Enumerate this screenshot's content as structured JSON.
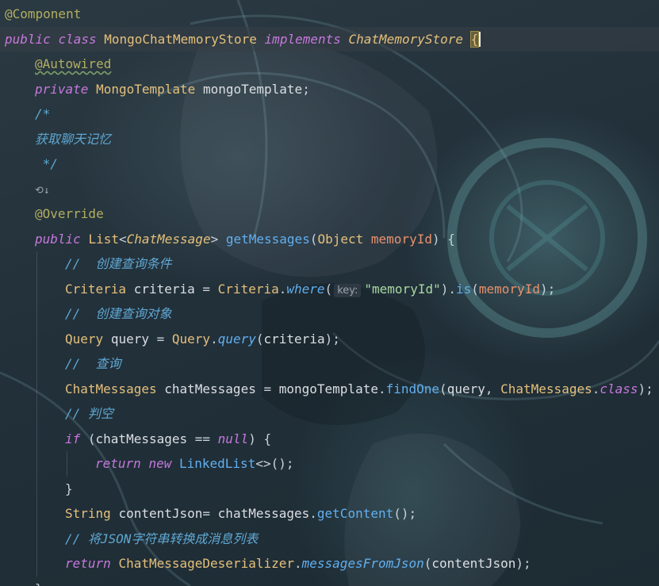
{
  "editor": {
    "language": "Java",
    "lines": [
      {
        "indent": 0,
        "tokens": [
          {
            "t": "@Component",
            "c": "ann"
          }
        ]
      },
      {
        "indent": 0,
        "active": true,
        "tokens": [
          {
            "t": "public",
            "c": "kw"
          },
          {
            "t": " ",
            "c": "punc"
          },
          {
            "t": "class",
            "c": "kw"
          },
          {
            "t": " ",
            "c": "punc"
          },
          {
            "t": "MongoChatMemoryStore",
            "c": "type"
          },
          {
            "t": " ",
            "c": "punc"
          },
          {
            "t": "implements",
            "c": "kw"
          },
          {
            "t": " ",
            "c": "punc"
          },
          {
            "t": "ChatMemoryStore",
            "c": "itype"
          },
          {
            "t": " ",
            "c": "punc"
          },
          {
            "t": "{",
            "c": "brace-hl",
            "caret": true
          }
        ]
      },
      {
        "indent": 1,
        "tokens": [
          {
            "t": "@Autowired",
            "c": "ann squiggle"
          }
        ]
      },
      {
        "indent": 1,
        "tokens": [
          {
            "t": "private",
            "c": "kw"
          },
          {
            "t": " ",
            "c": "punc"
          },
          {
            "t": "MongoTemplate",
            "c": "type"
          },
          {
            "t": " ",
            "c": "punc"
          },
          {
            "t": "mongoTemplate",
            "c": "var"
          },
          {
            "t": ";",
            "c": "punc"
          }
        ]
      },
      {
        "indent": 1,
        "tokens": [
          {
            "t": "/*",
            "c": "cmt"
          }
        ]
      },
      {
        "indent": 1,
        "tokens": [
          {
            "t": "获取聊天记忆",
            "c": "cmt"
          }
        ]
      },
      {
        "indent": 1,
        "tokens": [
          {
            "t": " */",
            "c": "cmt"
          }
        ]
      },
      {
        "indent": 1,
        "tokens": [
          {
            "t": "⟲↓",
            "c": "gutter-icon"
          }
        ]
      },
      {
        "indent": 1,
        "tokens": [
          {
            "t": "@Override",
            "c": "ann"
          }
        ]
      },
      {
        "indent": 1,
        "tokens": [
          {
            "t": "public",
            "c": "kw"
          },
          {
            "t": " ",
            "c": "punc"
          },
          {
            "t": "List",
            "c": "type"
          },
          {
            "t": "<",
            "c": "punc"
          },
          {
            "t": "ChatMessage",
            "c": "itype"
          },
          {
            "t": ">",
            "c": "punc"
          },
          {
            "t": " ",
            "c": "punc"
          },
          {
            "t": "getMessages",
            "c": "fn"
          },
          {
            "t": "(",
            "c": "punc"
          },
          {
            "t": "Object",
            "c": "type"
          },
          {
            "t": " ",
            "c": "punc"
          },
          {
            "t": "memoryId",
            "c": "param"
          },
          {
            "t": ") {",
            "c": "punc"
          }
        ]
      },
      {
        "indent": 2,
        "tokens": [
          {
            "t": "//  创建查询条件",
            "c": "cmt"
          }
        ]
      },
      {
        "indent": 2,
        "tokens": [
          {
            "t": "Criteria",
            "c": "type"
          },
          {
            "t": " ",
            "c": "punc"
          },
          {
            "t": "criteria",
            "c": "var"
          },
          {
            "t": " = ",
            "c": "punc"
          },
          {
            "t": "Criteria",
            "c": "type"
          },
          {
            "t": ".",
            "c": "punc"
          },
          {
            "t": "where",
            "c": "sfn"
          },
          {
            "t": "(",
            "c": "punc"
          },
          {
            "t": "key:",
            "c": "hint"
          },
          {
            "t": "\"memoryId\"",
            "c": "str"
          },
          {
            "t": ").",
            "c": "punc"
          },
          {
            "t": "is",
            "c": "fn"
          },
          {
            "t": "(",
            "c": "punc"
          },
          {
            "t": "memoryId",
            "c": "param"
          },
          {
            "t": ");",
            "c": "punc"
          }
        ]
      },
      {
        "indent": 2,
        "tokens": [
          {
            "t": "//  创建查询对象",
            "c": "cmt"
          }
        ]
      },
      {
        "indent": 2,
        "tokens": [
          {
            "t": "Query",
            "c": "type"
          },
          {
            "t": " ",
            "c": "punc"
          },
          {
            "t": "query",
            "c": "var"
          },
          {
            "t": " = ",
            "c": "punc"
          },
          {
            "t": "Query",
            "c": "type"
          },
          {
            "t": ".",
            "c": "punc"
          },
          {
            "t": "query",
            "c": "sfn"
          },
          {
            "t": "(",
            "c": "punc"
          },
          {
            "t": "criteria",
            "c": "var"
          },
          {
            "t": ");",
            "c": "punc"
          }
        ]
      },
      {
        "indent": 2,
        "tokens": [
          {
            "t": "//  查询",
            "c": "cmt"
          }
        ]
      },
      {
        "indent": 2,
        "tokens": [
          {
            "t": "ChatMessages",
            "c": "type"
          },
          {
            "t": " ",
            "c": "punc"
          },
          {
            "t": "chatMessages",
            "c": "var"
          },
          {
            "t": " = ",
            "c": "punc"
          },
          {
            "t": "mongoTemplate",
            "c": "var"
          },
          {
            "t": ".",
            "c": "punc"
          },
          {
            "t": "findOne",
            "c": "fn"
          },
          {
            "t": "(",
            "c": "punc"
          },
          {
            "t": "query",
            "c": "var"
          },
          {
            "t": ", ",
            "c": "punc"
          },
          {
            "t": "ChatMessages",
            "c": "type"
          },
          {
            "t": ".",
            "c": "punc"
          },
          {
            "t": "class",
            "c": "kw"
          },
          {
            "t": ");",
            "c": "punc"
          }
        ]
      },
      {
        "indent": 2,
        "tokens": [
          {
            "t": "// 判空",
            "c": "cmt"
          }
        ]
      },
      {
        "indent": 2,
        "tokens": [
          {
            "t": "if",
            "c": "kw"
          },
          {
            "t": " (",
            "c": "punc"
          },
          {
            "t": "chatMessages",
            "c": "var"
          },
          {
            "t": " == ",
            "c": "punc"
          },
          {
            "t": "null",
            "c": "kw"
          },
          {
            "t": ") {",
            "c": "punc"
          }
        ]
      },
      {
        "indent": 3,
        "tokens": [
          {
            "t": "return",
            "c": "kw"
          },
          {
            "t": " ",
            "c": "punc"
          },
          {
            "t": "new",
            "c": "kw"
          },
          {
            "t": " ",
            "c": "punc"
          },
          {
            "t": "LinkedList",
            "c": "fn"
          },
          {
            "t": "<>();",
            "c": "punc"
          }
        ]
      },
      {
        "indent": 2,
        "tokens": [
          {
            "t": "}",
            "c": "punc"
          }
        ]
      },
      {
        "indent": 2,
        "tokens": [
          {
            "t": "String",
            "c": "type"
          },
          {
            "t": " ",
            "c": "punc"
          },
          {
            "t": "contentJson",
            "c": "var"
          },
          {
            "t": "= ",
            "c": "punc"
          },
          {
            "t": "chatMessages",
            "c": "var"
          },
          {
            "t": ".",
            "c": "punc"
          },
          {
            "t": "getContent",
            "c": "fn"
          },
          {
            "t": "();",
            "c": "punc"
          }
        ]
      },
      {
        "indent": 2,
        "tokens": [
          {
            "t": "// 将JSON字符串转换成消息列表",
            "c": "cmt"
          }
        ]
      },
      {
        "indent": 2,
        "tokens": [
          {
            "t": "return",
            "c": "kw"
          },
          {
            "t": " ",
            "c": "punc"
          },
          {
            "t": "ChatMessageDeserializer",
            "c": "type"
          },
          {
            "t": ".",
            "c": "punc"
          },
          {
            "t": "messagesFromJson",
            "c": "sfn"
          },
          {
            "t": "(",
            "c": "punc"
          },
          {
            "t": "contentJson",
            "c": "var"
          },
          {
            "t": ");",
            "c": "punc"
          }
        ]
      },
      {
        "indent": 1,
        "tokens": [
          {
            "t": "}",
            "c": "punc"
          }
        ]
      }
    ]
  }
}
